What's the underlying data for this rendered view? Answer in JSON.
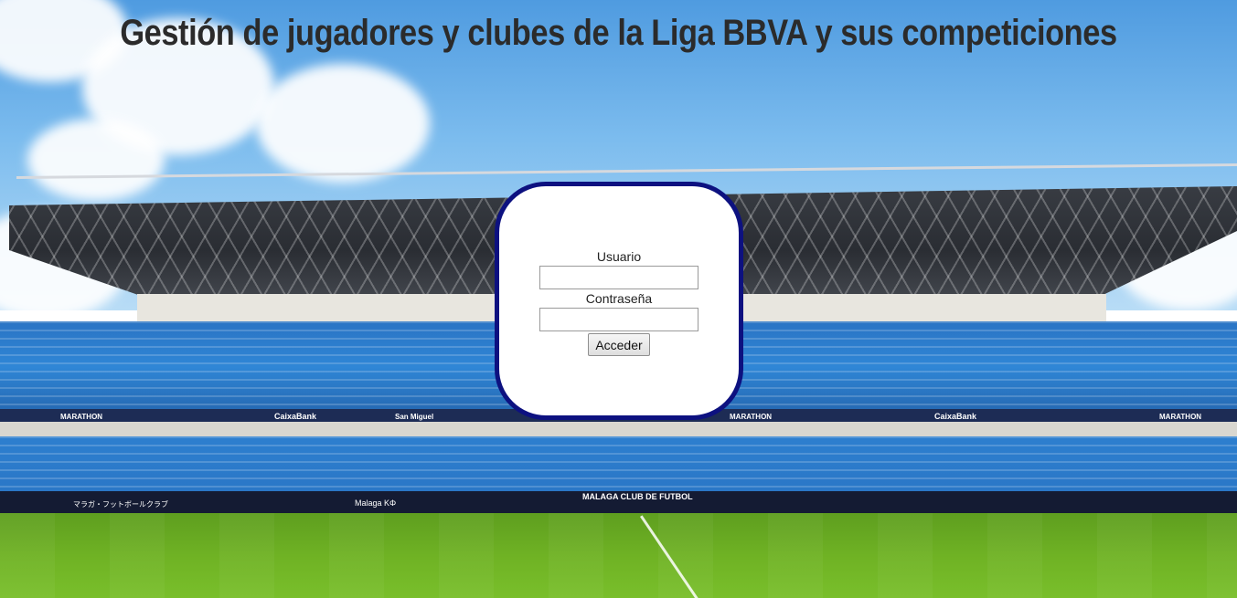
{
  "page": {
    "title": "Gestión de jugadores y clubes de la Liga BBVA y sus competiciones"
  },
  "login": {
    "username_label": "Usuario",
    "username_value": "",
    "password_label": "Contraseña",
    "password_value": "",
    "submit_label": "Acceder"
  },
  "background": {
    "description_icon": "stadium-photo",
    "ad_boards": [
      "MARATHON",
      "CaixaBank",
      "San Miguel",
      "MALAGA CLUB DE FUTBOL",
      "Malaga KΦ",
      "マラガ・フットボールクラブ"
    ]
  },
  "colors": {
    "panel_border": "#0d1180",
    "panel_background": "#ffffff",
    "title_text": "#2b2b2b"
  }
}
